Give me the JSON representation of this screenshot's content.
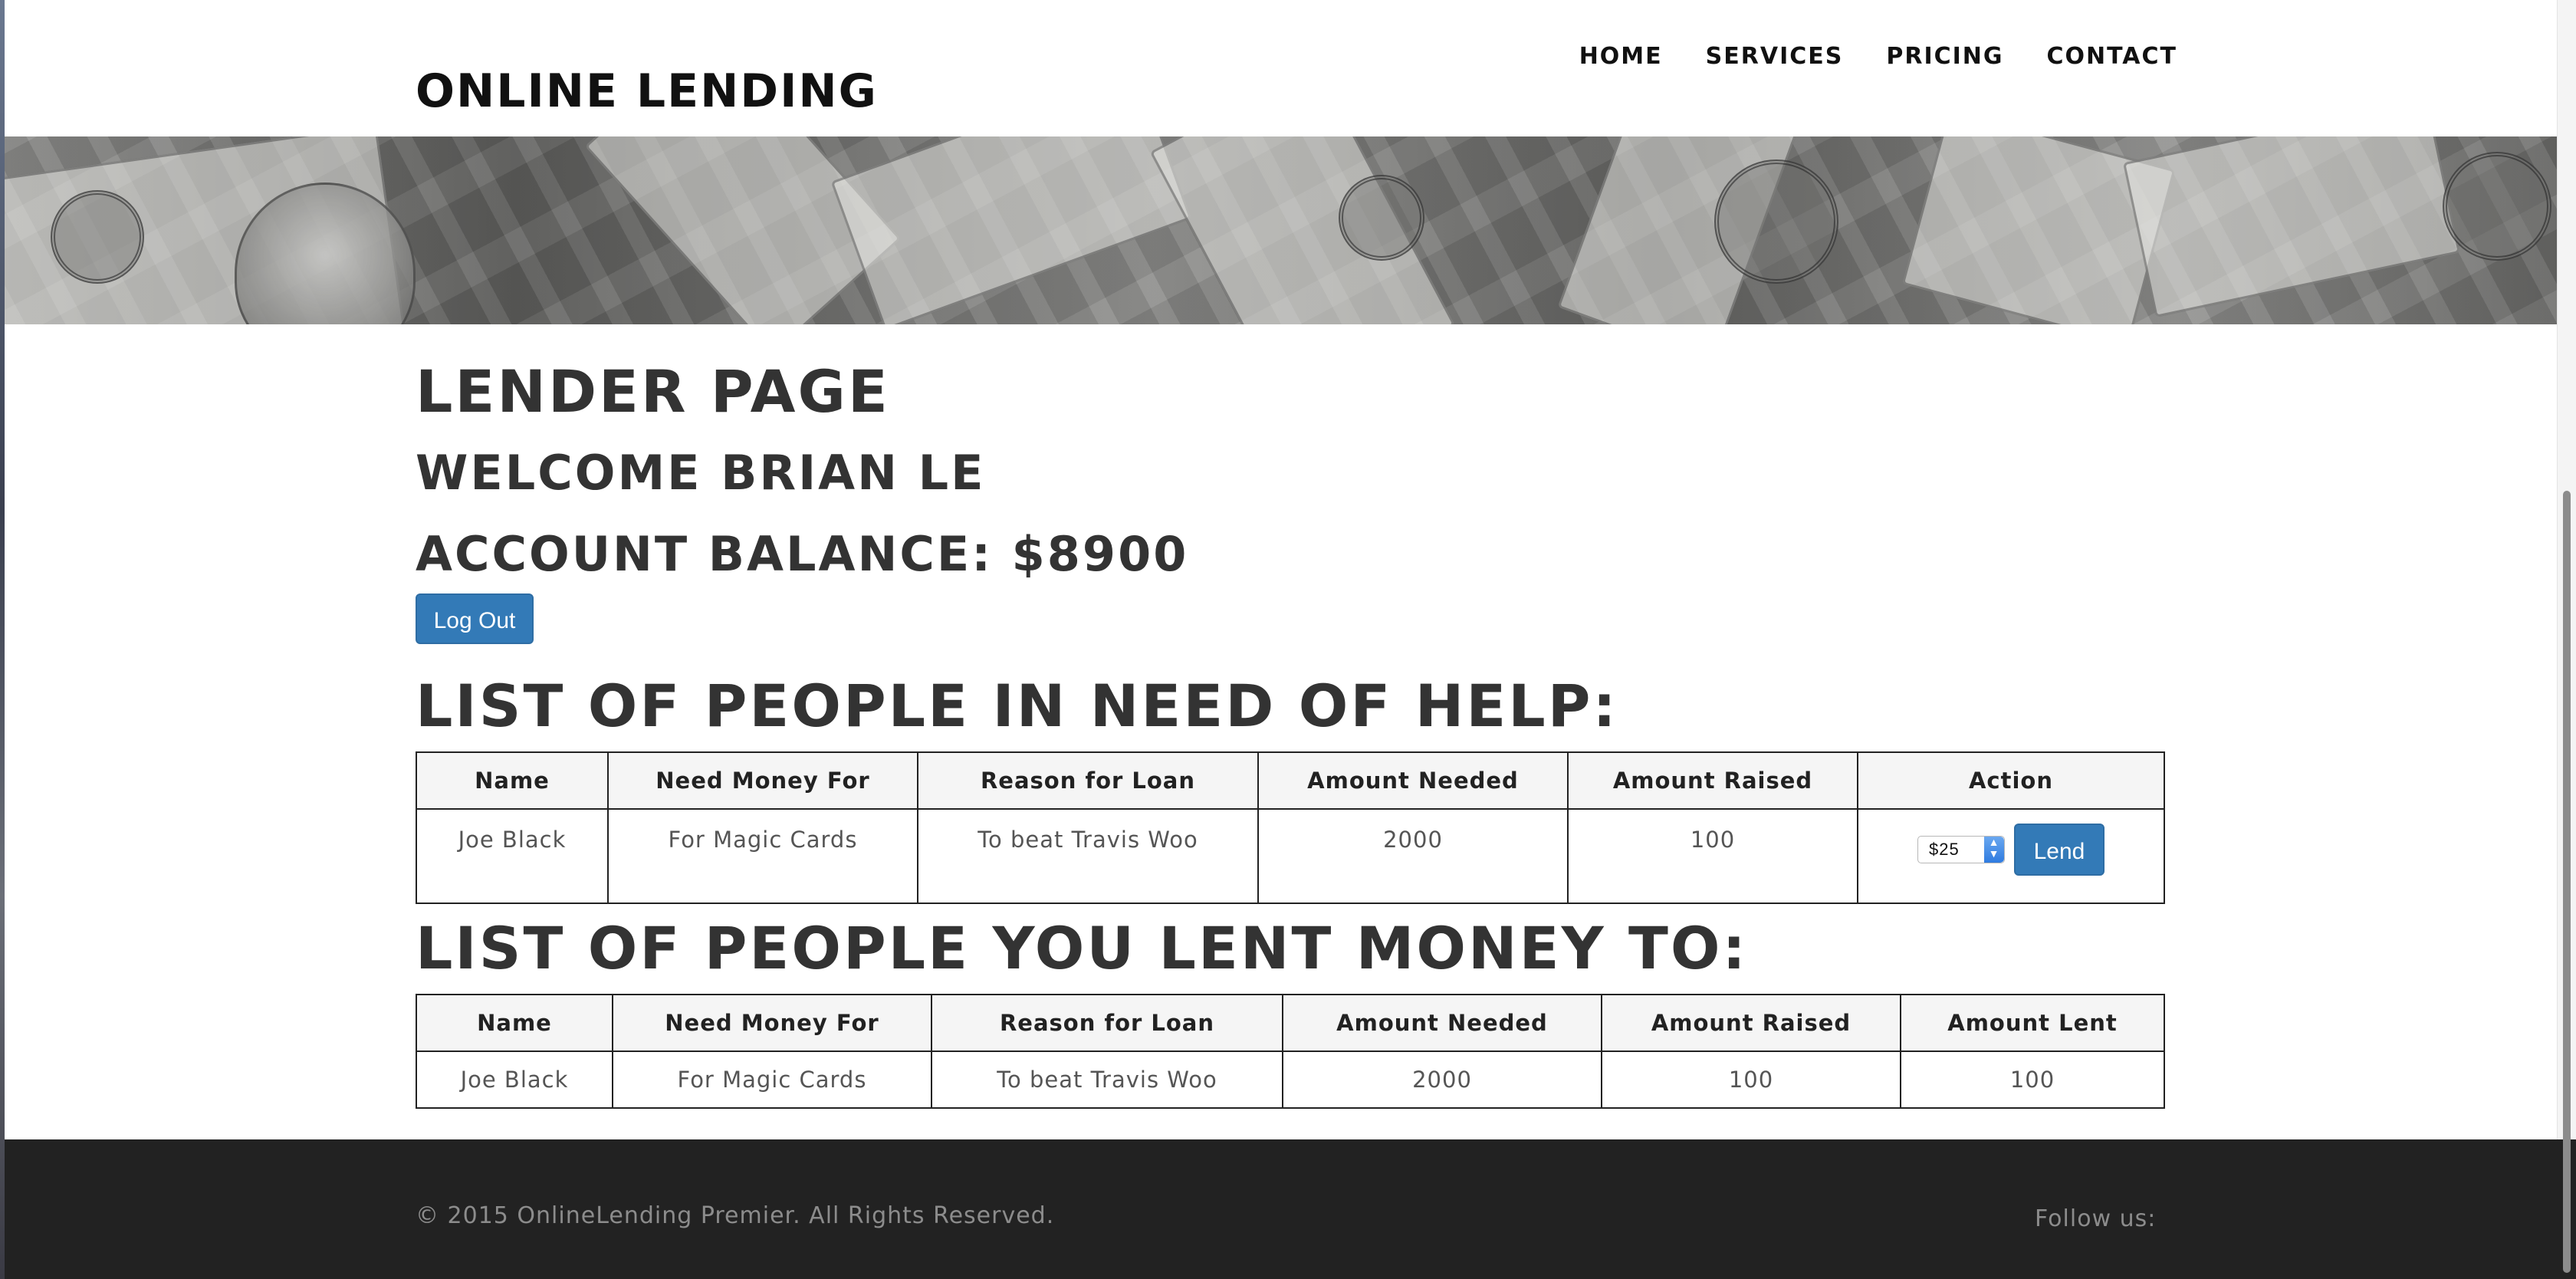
{
  "header": {
    "brand": "ONLINE LENDING",
    "nav": [
      "HOME",
      "SERVICES",
      "PRICING",
      "CONTACT"
    ]
  },
  "page": {
    "title": "LENDER PAGE",
    "welcome": "WELCOME BRIAN LE",
    "balance": "ACCOUNT BALANCE: $8900",
    "logout_label": "Log Out"
  },
  "need_help": {
    "heading": "LIST OF PEOPLE IN NEED OF HELP:",
    "columns": [
      "Name",
      "Need Money For",
      "Reason for Loan",
      "Amount Needed",
      "Amount Raised",
      "Action"
    ],
    "rows": [
      {
        "name": "Joe Black",
        "need_money_for": "For Magic Cards",
        "reason": "To beat Travis Woo",
        "amount_needed": "2000",
        "amount_raised": "100",
        "select_value": "$25",
        "action_label": "Lend"
      }
    ]
  },
  "lent_to": {
    "heading": "LIST OF PEOPLE YOU LENT MONEY TO:",
    "columns": [
      "Name",
      "Need Money For",
      "Reason for Loan",
      "Amount Needed",
      "Amount Raised",
      "Amount Lent"
    ],
    "rows": [
      {
        "name": "Joe Black",
        "need_money_for": "For Magic Cards",
        "reason": "To beat Travis Woo",
        "amount_needed": "2000",
        "amount_raised": "100",
        "amount_lent": "100"
      }
    ]
  },
  "footer": {
    "copyright": "© 2015 OnlineLending Premier. All Rights Reserved.",
    "follow": "Follow us:"
  },
  "colors": {
    "primary_button": "#337ab7",
    "footer_bg": "#222222",
    "heading_text": "#333333"
  },
  "icons": {
    "select_spinner": "up-down-arrows-icon"
  }
}
